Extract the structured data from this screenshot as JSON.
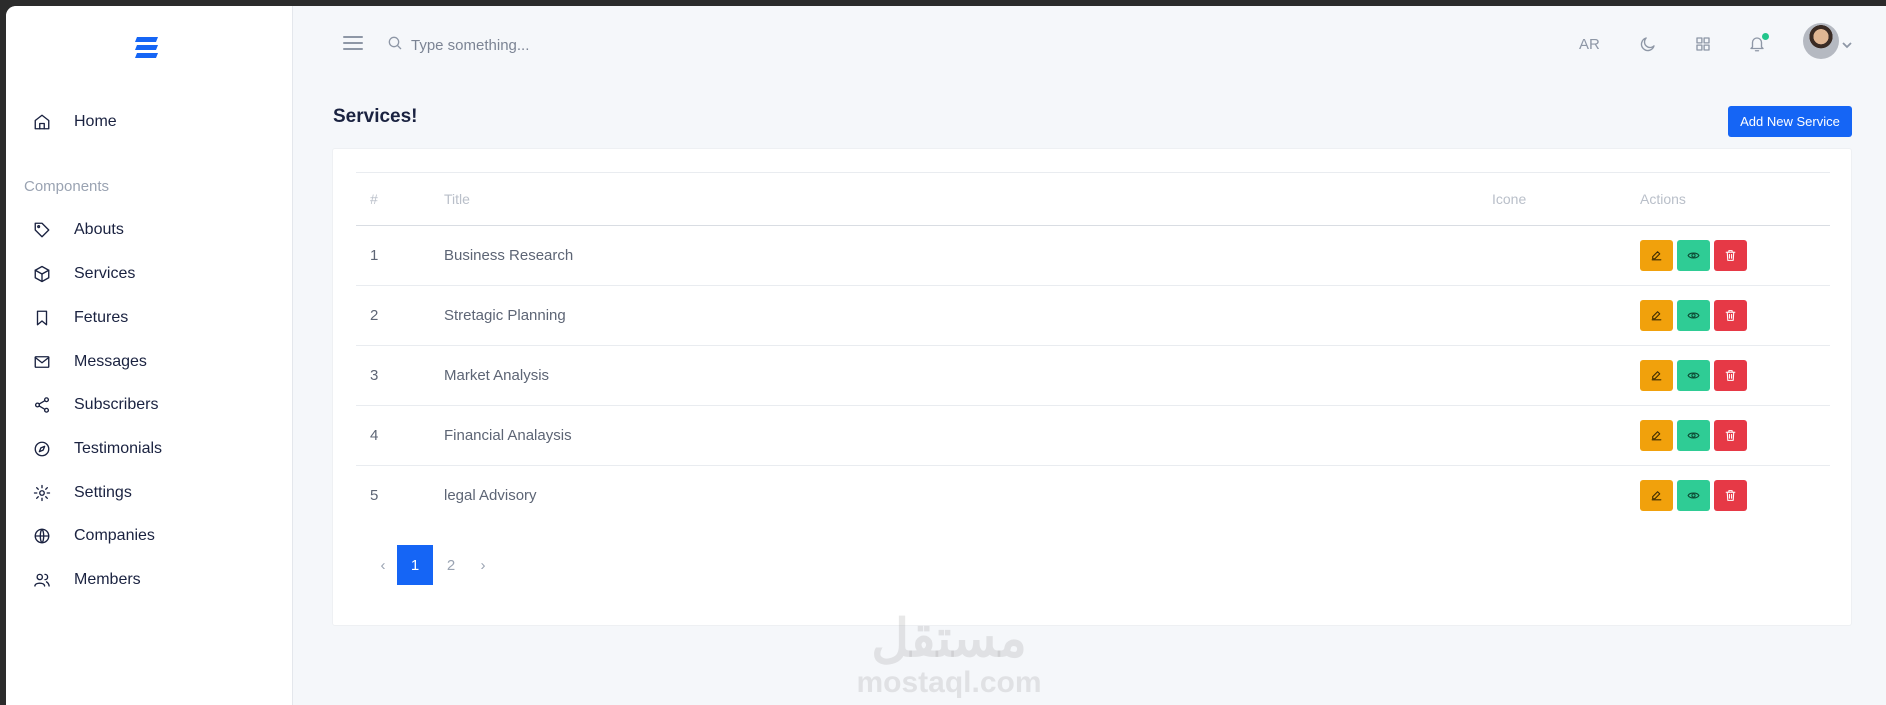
{
  "sidebar": {
    "home_label": "Home",
    "section_label": "Components",
    "items": [
      {
        "label": "Abouts",
        "icon": "tag-icon"
      },
      {
        "label": "Services",
        "icon": "box-icon"
      },
      {
        "label": "Fetures",
        "icon": "bookmark-icon"
      },
      {
        "label": "Messages",
        "icon": "mail-icon"
      },
      {
        "label": "Subscribers",
        "icon": "share-icon"
      },
      {
        "label": "Testimonials",
        "icon": "compass-icon"
      },
      {
        "label": "Settings",
        "icon": "gear-icon"
      },
      {
        "label": "Companies",
        "icon": "globe-icon"
      },
      {
        "label": "Members",
        "icon": "users-icon"
      }
    ]
  },
  "topbar": {
    "search_placeholder": "Type something...",
    "lang": "AR"
  },
  "page": {
    "title": "Services!",
    "add_button": "Add New Service"
  },
  "table": {
    "headers": [
      "#",
      "Title",
      "Icone",
      "Actions"
    ],
    "rows": [
      {
        "num": "1",
        "title": "Business Research"
      },
      {
        "num": "2",
        "title": "Stretagic Planning"
      },
      {
        "num": "3",
        "title": "Market Analysis"
      },
      {
        "num": "4",
        "title": "Financial Analaysis"
      },
      {
        "num": "5",
        "title": "legal Advisory"
      }
    ]
  },
  "pagination": {
    "prev": "‹",
    "pages": [
      "1",
      "2"
    ],
    "next": "›",
    "active": "1"
  },
  "watermark": {
    "arabic": "مستقل",
    "latin": "mostaql.com"
  },
  "colors": {
    "primary": "#1565f5",
    "edit": "#f1a10c",
    "view": "#2fcc95",
    "delete": "#e63946",
    "notification_dot": "#22c58b"
  }
}
